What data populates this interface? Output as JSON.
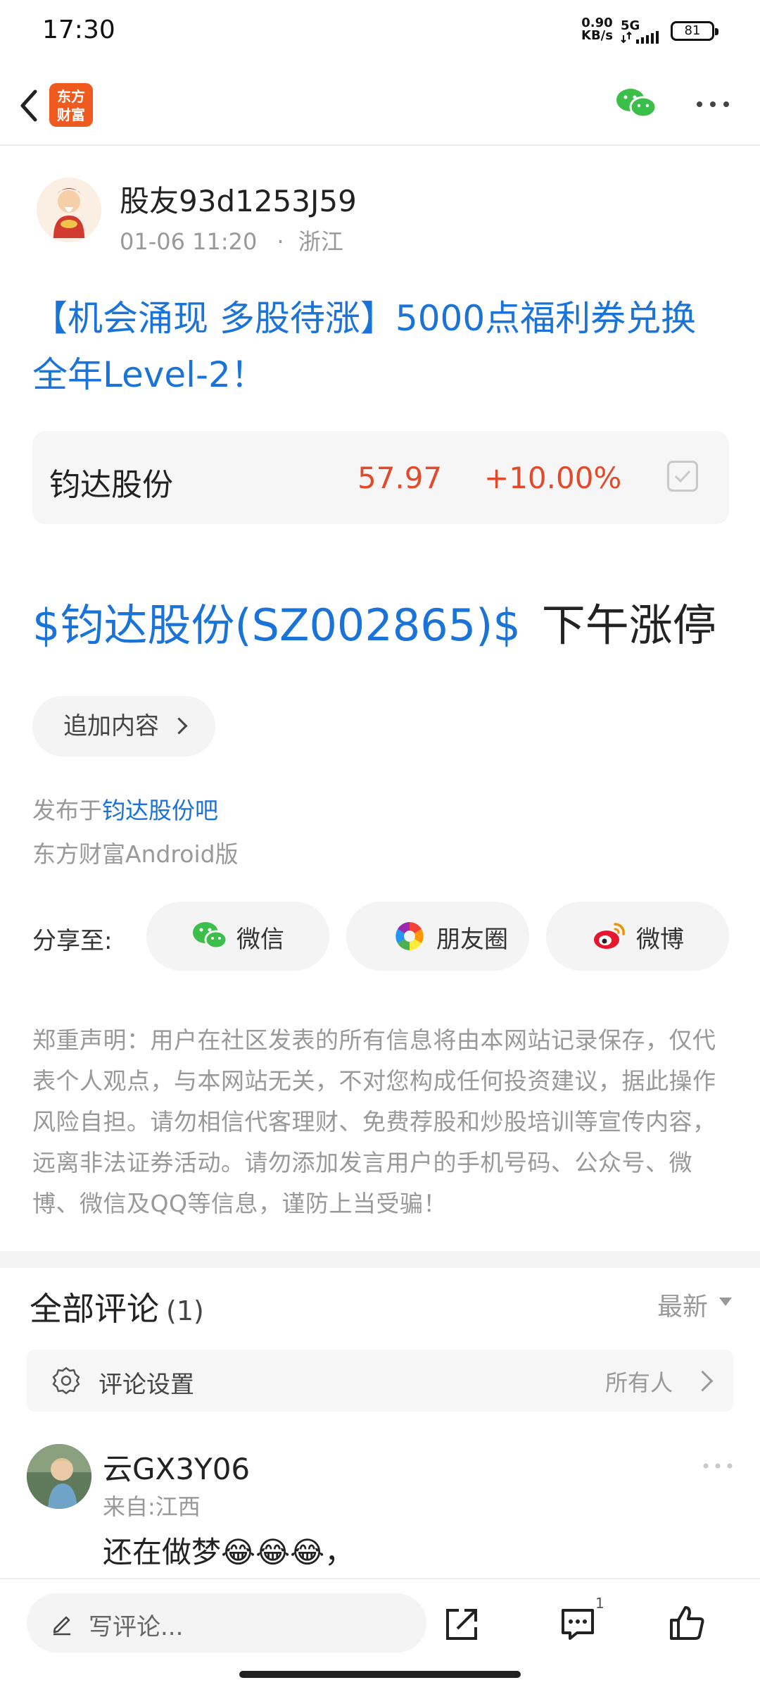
{
  "status_bar": {
    "time": "17:30",
    "net_speed_value": "0.90",
    "net_speed_unit": "KB/s",
    "network": "5G",
    "battery": "81"
  },
  "header": {
    "logo_line1": "东方",
    "logo_line2": "财富"
  },
  "post": {
    "author": "股友93d1253J59",
    "date": "01-06 11:20",
    "location": "浙江",
    "title": "【机会涌现 多股待涨】5000点福利券兑换全年Level-2！",
    "stock_card": {
      "name": "钧达股份",
      "price": "57.97",
      "change": "+10.00%"
    },
    "body_stock_link": "$钧达股份(SZ002865)$",
    "body_text": "下午涨停",
    "add_content_label": "追加内容",
    "publish_prefix": "发布于",
    "publish_forum": "钧达股份吧",
    "client": "东方财富Android版"
  },
  "share": {
    "label": "分享至:",
    "wechat": "微信",
    "moments": "朋友圈",
    "weibo": "微博"
  },
  "disclaimer": "郑重声明：用户在社区发表的所有信息将由本网站记录保存，仅代表个人观点，与本网站无关，不对您构成任何投资建议，据此操作风险自担。请勿相信代客理财、免费荐股和炒股培训等宣传内容，远离非法证券活动。请勿添加发言用户的手机号码、公众号、微博、微信及QQ等信息，谨防上当受骗！",
  "comments": {
    "title": "全部评论",
    "count": "(1)",
    "sort": "最新",
    "settings_label": "评论设置",
    "settings_value": "所有人",
    "items": [
      {
        "user": "云GX3Y06",
        "location": "来自:江西",
        "text": "还在做梦😂😂😂，"
      }
    ]
  },
  "bottom_bar": {
    "comment_placeholder": "写评论...",
    "comment_badge": "1"
  },
  "colors": {
    "link_blue": "#1a73d9",
    "rise_red": "#e34a2a",
    "brand_orange": "#ef5a1f",
    "wechat_green": "#3bbf4a"
  },
  "icons": [
    "back-arrow-icon",
    "wechat-icon",
    "more-icon",
    "check-icon",
    "chevron-right-icon",
    "moments-icon",
    "weibo-icon",
    "gear-icon",
    "pen-icon",
    "share-out-icon",
    "comment-icon",
    "thumbs-up-icon"
  ]
}
